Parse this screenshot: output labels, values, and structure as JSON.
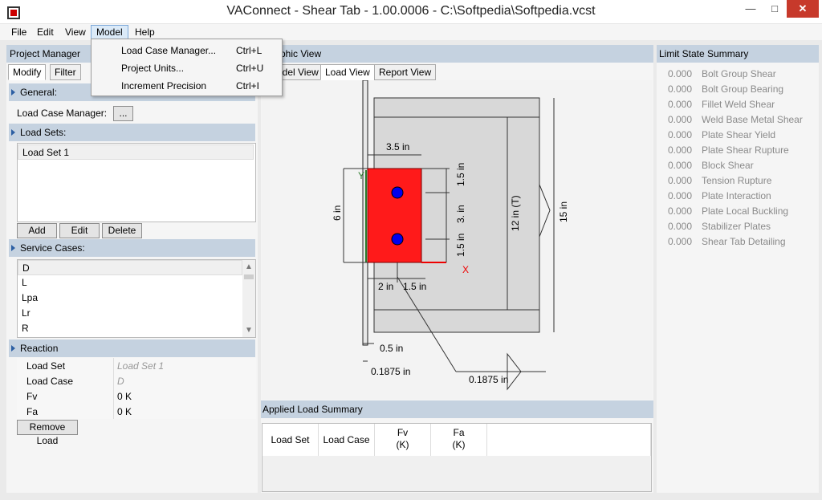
{
  "window": {
    "title": "VAConnect - Shear Tab - 1.00.0006 - C:\\Softpedia\\Softpedia.vcst",
    "minimize": "—",
    "maximize": "□",
    "close": "✕"
  },
  "menu": {
    "items": [
      "File",
      "Edit",
      "View",
      "Model",
      "Help"
    ],
    "active": "Model",
    "dropdown": [
      {
        "label": "Load Case Manager...",
        "shortcut": "Ctrl+L"
      },
      {
        "label": "Project Units...",
        "shortcut": "Ctrl+U"
      },
      {
        "label": "Increment Precision",
        "shortcut": "Ctrl+I"
      }
    ]
  },
  "project_manager": {
    "title": "Project Manager",
    "tabs": [
      "Modify",
      "Filter"
    ],
    "general_label": "General:",
    "load_case_manager_label": "Load Case Manager:",
    "load_case_manager_button": "...",
    "load_sets_label": "Load Sets:",
    "load_sets": [
      "Load Set 1"
    ],
    "add_button": "Add",
    "edit_button": "Edit",
    "delete_button": "Delete",
    "service_cases_label": "Service Cases:",
    "service_cases": [
      "D",
      "L",
      "Lpa",
      "Lr",
      "R"
    ],
    "reaction_label": "Reaction",
    "reaction_props": [
      {
        "label": "Load Set",
        "value": "Load Set 1"
      },
      {
        "label": "Load Case",
        "value": "D"
      },
      {
        "label": "Fv",
        "value": "0 K"
      },
      {
        "label": "Fa",
        "value": "0 K"
      }
    ],
    "remove_load_button": "Remove Load"
  },
  "graphic_view": {
    "title": "Graphic View",
    "tabs": [
      "Model View",
      "Load View",
      "Report View"
    ],
    "selected_tab": "Load View",
    "dims": {
      "d_3_5": "3.5 in",
      "d_1_5_top": "1.5 in",
      "d_3": "3. in",
      "d_1_5_bot": "1.5 in",
      "d_6": "6 in",
      "d_12": "12 in (T)",
      "d_15": "15 in",
      "d_2": "2 in",
      "d_1_5_h": "1.5 in",
      "d_0_5": "0.5 in",
      "d_01875a": "0.1875 in",
      "d_01875b": "0.1875 in",
      "axis_y": "Y",
      "axis_x": "X"
    },
    "colors": {
      "plate": "#ff1a1a",
      "bolt": "#0000ee",
      "beam": "#d8d8d8"
    }
  },
  "applied_load_summary": {
    "title": "Applied Load Summary",
    "columns": [
      "Load Set",
      "Load Case",
      "Fv\n(K)",
      "Fa\n(K)"
    ]
  },
  "limit_state_summary": {
    "title": "Limit State Summary",
    "rows": [
      {
        "value": "0.000",
        "name": "Bolt Group Shear"
      },
      {
        "value": "0.000",
        "name": "Bolt Group Bearing"
      },
      {
        "value": "0.000",
        "name": "Fillet Weld Shear"
      },
      {
        "value": "0.000",
        "name": "Weld Base Metal Shear"
      },
      {
        "value": "0.000",
        "name": "Plate Shear Yield"
      },
      {
        "value": "0.000",
        "name": "Plate Shear Rupture"
      },
      {
        "value": "0.000",
        "name": "Block Shear"
      },
      {
        "value": "0.000",
        "name": "Tension Rupture"
      },
      {
        "value": "0.000",
        "name": "Plate Interaction"
      },
      {
        "value": "0.000",
        "name": "Plate Local Buckling"
      },
      {
        "value": "0.000",
        "name": "Stabilizer Plates"
      },
      {
        "value": "0.000",
        "name": "Shear Tab Detailing"
      }
    ]
  }
}
